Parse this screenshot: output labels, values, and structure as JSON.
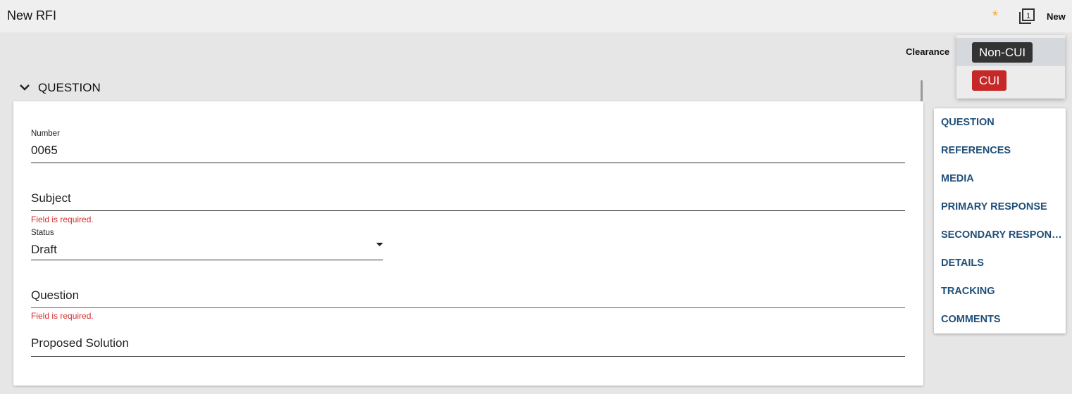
{
  "header": {
    "title": "New RFI",
    "dirty_indicator": "*",
    "count_icon": "counter-1-icon",
    "new_label": "New"
  },
  "clearance": {
    "label": "Clearance",
    "options": [
      {
        "label": "Non-CUI",
        "color": "#333333",
        "selected": true
      },
      {
        "label": "CUI",
        "color": "#c62828",
        "selected": false
      }
    ]
  },
  "section": {
    "title": "QUESTION",
    "toggle_icon": "chevron-down-icon"
  },
  "form": {
    "number": {
      "label": "Number",
      "value": "0065"
    },
    "subject": {
      "placeholder": "Subject",
      "error": "Field is required."
    },
    "status": {
      "label": "Status",
      "value": "Draft"
    },
    "question": {
      "placeholder": "Question",
      "error": "Field is required."
    },
    "proposed_solution": {
      "placeholder": "Proposed Solution"
    }
  },
  "nav": {
    "items": [
      "QUESTION",
      "REFERENCES",
      "MEDIA",
      "PRIMARY RESPONSE",
      "SECONDARY RESPONSE",
      "DETAILS",
      "TRACKING",
      "COMMENTS"
    ]
  },
  "colors": {
    "accent_link": "#1f4e79",
    "error": "#d32f2f",
    "dirty": "#f5a623"
  }
}
